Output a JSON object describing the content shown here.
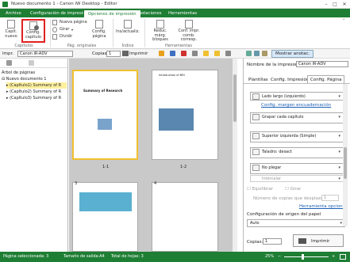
{
  "window": {
    "title": "Nuevo documento 1 - Canon iW Desktop - Editor"
  },
  "menu": {
    "tabs": [
      {
        "label": "Archivo"
      },
      {
        "label": "Configuración de impresión"
      },
      {
        "label": "Opciones de impresión"
      },
      {
        "label": "Anotaciones"
      },
      {
        "label": "Herramientas"
      }
    ],
    "active_index": 2
  },
  "ribbon": {
    "chapters_group": "Capítulos",
    "page_options_group": "Pág. originales",
    "index_group": "Índice",
    "tools_group": "Herramientas",
    "new_chapter": "Capít. nuevo",
    "config_chapter": "Config. capítulo",
    "new_page": "Nueva página",
    "rotate": "Girar",
    "split": "Dividir",
    "config_page": "Config. página",
    "insert_index": "Ins/actualiz.",
    "reduce_margin": "Reduc. márg. bloques",
    "combined_print": "Conf. impr. comb. corresp."
  },
  "toolbar2": {
    "printer_label": "Impr.",
    "printer_value": "Canon iR-ADV",
    "copies_label": "Copias",
    "copies_value": "1",
    "print_label": "Imprimir",
    "show_notes": "Mostrar anotac."
  },
  "tree": {
    "title": "Árbol de páginas",
    "root": "Nuevo documento 1",
    "chapters": [
      "(Capítulo1) Summary of R",
      "(Capítulo2) Summary of R",
      "(Capítulo3) Summary of R"
    ]
  },
  "pages": {
    "labels": [
      "1-1",
      "1-2",
      "3",
      "4"
    ],
    "p1_title": "Summary of Research",
    "p2_title": "Introduction of BRI"
  },
  "right": {
    "printer_name_label": "Nombre de la impresora:",
    "printer_name": "Canon iR-ADV",
    "tabs": [
      "Plantillas",
      "Config. Impresión",
      "Config. Página"
    ],
    "binding": "Lado largo (izquierdo)",
    "binding_link": "Config. margen encuadernación",
    "staple": "Grapar cada capítulo",
    "staple_pos": "Superior izquierda (Simple)",
    "punch": "Taladro: desact",
    "fold": "No plegar",
    "interleave": "Intercalar",
    "equalize": "Equilibrar",
    "offset": "Girar",
    "copies_per_output": "Número de copias que desplazar",
    "copies_per_output_value": "1",
    "finishing_link": "Herramienta opciones",
    "paper_source_title": "Configuración de origen del papel",
    "paper_source": "Auto",
    "copies_label": "Copias:",
    "copies_value": "1",
    "print_btn": "Imprimir"
  },
  "status": {
    "selected": "Página seleccionada: 3",
    "size": "Tamaño de salida:A4",
    "total": "Total de hojas: 3",
    "zoom": "25%"
  }
}
